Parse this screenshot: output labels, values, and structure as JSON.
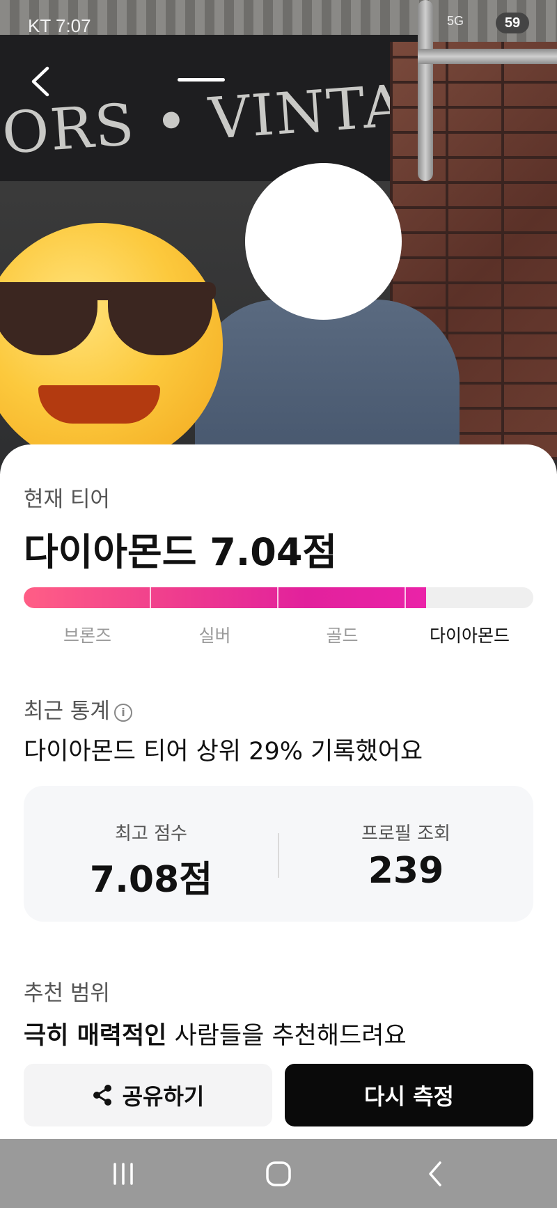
{
  "status_bar": {
    "carrier_time": "KT 7:07",
    "network": "5G",
    "battery": "59"
  },
  "hero": {
    "sign_text": "ORS • VINTAGE • TOY"
  },
  "tier": {
    "label": "현재 티어",
    "title": "다이아몬드 7.04점",
    "progress_fraction": 0.79,
    "levels": [
      "브론즈",
      "실버",
      "골드",
      "다이아몬드"
    ],
    "active_index": 3
  },
  "stats": {
    "label": "최근 통계",
    "description": "다이아몬드 티어 상위 29% 기록했어요",
    "items": [
      {
        "key": "최고 점수",
        "value": "7.08점"
      },
      {
        "key": "프로필 조회",
        "value": "239"
      }
    ]
  },
  "recommend": {
    "label": "추천 범위",
    "bold": "극히 매력적인",
    "rest": " 사람들을 추천해드려요"
  },
  "actions": {
    "share_label": "공유하기",
    "retry_label": "다시 측정"
  },
  "colors": {
    "accent_start": "#ff5e86",
    "accent_end": "#ea23a8",
    "primary_button": "#0a0a0a"
  },
  "icons": {
    "back": "chevron-left-icon",
    "share": "share-icon",
    "info": "info-icon",
    "nav_recents": "recents-icon",
    "nav_home": "home-icon",
    "nav_back": "back-icon"
  }
}
